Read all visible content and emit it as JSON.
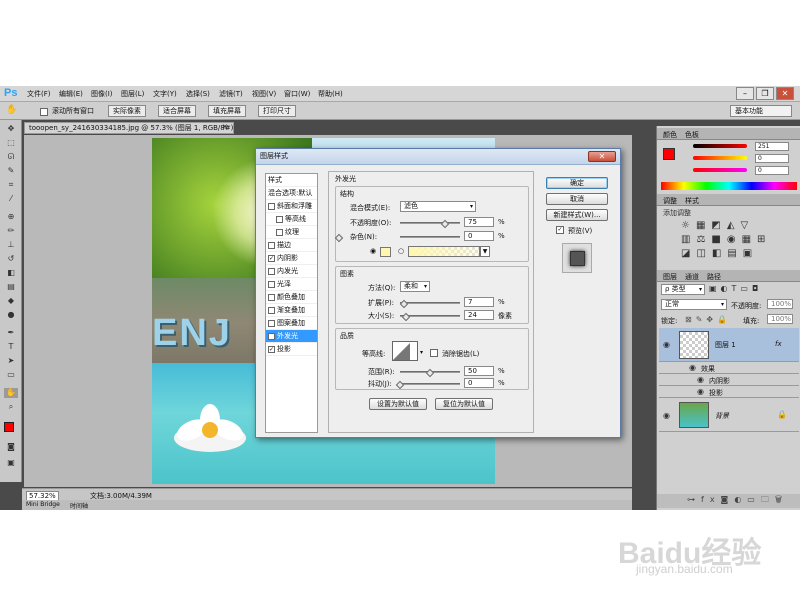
{
  "app": {
    "logo": "Ps",
    "menus": [
      "文件(F)",
      "编辑(E)",
      "图像(I)",
      "图层(L)",
      "文字(Y)",
      "选择(S)",
      "滤镜(T)",
      "视图(V)",
      "窗口(W)",
      "帮助(H)"
    ],
    "window_buttons": [
      "–",
      "❐",
      "✕"
    ]
  },
  "options_bar": {
    "scroll_all_label": "滚动所有窗口",
    "actual_pixels": "实际像素",
    "fit_screen": "适合屏幕",
    "fill_screen": "填充屏幕",
    "print_size": "打印尺寸",
    "workspace": "基本功能"
  },
  "document": {
    "tab_title": "tooopen_sy_241630334185.jpg @ 57.3% (图层 1, RGB/8#) *",
    "close_glyph": "✕",
    "image_text": "ENJ"
  },
  "status": {
    "zoom": "57.32%",
    "doc_size": "文档:3.00M/4.39M"
  },
  "bottom_tabs": [
    "Mini Bridge",
    "时间轴"
  ],
  "panels": {
    "color_tabs": [
      "颜色",
      "色板"
    ],
    "color_values": [
      "251",
      "0",
      "0"
    ],
    "adjust_tabs": [
      "调整",
      "样式"
    ],
    "adjust_hint": "添加调整",
    "layers_tabs": [
      "图层",
      "通道",
      "路径"
    ],
    "kind_label": "ρ 类型",
    "blend_mode": "正常",
    "opacity_label": "不透明度:",
    "opacity_value": "100%",
    "lock_label": "锁定:",
    "fill_label": "填充:",
    "fill_value": "100%",
    "layers": [
      {
        "name": "图层 1",
        "fx": "fx"
      },
      {
        "name": "背景"
      }
    ],
    "effects_label": "效果",
    "effects": [
      "内阴影",
      "投影"
    ]
  },
  "dialog": {
    "title": "图层样式",
    "close": "✕",
    "styles_header": "样式",
    "blend_options": "混合选项:默认",
    "style_items": [
      {
        "label": "斜面和浮雕",
        "checked": false
      },
      {
        "label": "等高线",
        "checked": false
      },
      {
        "label": "纹理",
        "checked": false
      },
      {
        "label": "描边",
        "checked": false
      },
      {
        "label": "内阴影",
        "checked": true
      },
      {
        "label": "内发光",
        "checked": false
      },
      {
        "label": "光泽",
        "checked": false
      },
      {
        "label": "颜色叠加",
        "checked": false
      },
      {
        "label": "渐变叠加",
        "checked": false
      },
      {
        "label": "图案叠加",
        "checked": false
      },
      {
        "label": "外发光",
        "checked": true
      },
      {
        "label": "投影",
        "checked": true
      }
    ],
    "check_mark": "✓",
    "section_title": "外发光",
    "structure": {
      "label": "结构",
      "blend_mode_label": "混合模式(E):",
      "blend_mode_value": "滤色",
      "opacity_label": "不透明度(O):",
      "opacity_value": "75",
      "noise_label": "杂色(N):",
      "noise_value": "0",
      "pct": "%"
    },
    "elements": {
      "label": "图素",
      "method_label": "方法(Q):",
      "method_value": "柔和",
      "spread_label": "扩展(P):",
      "spread_value": "7",
      "size_label": "大小(S):",
      "size_value": "24",
      "size_unit": "像素"
    },
    "quality": {
      "label": "品质",
      "contour_label": "等高线:",
      "antialias_label": "消除锯齿(L)",
      "range_label": "范围(R):",
      "range_value": "50",
      "jitter_label": "抖动(J):",
      "jitter_value": "0"
    },
    "make_default": "设置为默认值",
    "reset_default": "复位为默认值",
    "ok": "确定",
    "cancel": "取消",
    "new_style": "新建样式(W)...",
    "preview_label": "预览(V)",
    "glow_color": "#fff7b0",
    "opacity_fraction": 0.75,
    "spread_fraction": 0.07,
    "size_fraction": 0.096,
    "range_fraction": 0.5
  },
  "watermark": {
    "brand": "Baidu经验",
    "url": "jingyan.baidu.com"
  }
}
